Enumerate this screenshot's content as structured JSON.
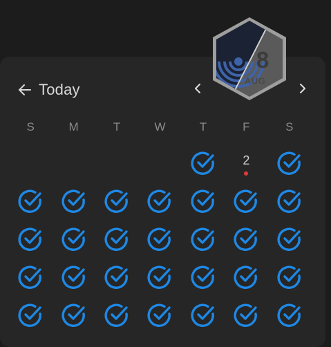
{
  "header": {
    "back_label": "Today",
    "prev_icon": "chevron-left-icon",
    "next_icon": "chevron-right-icon"
  },
  "badge": {
    "day": "8",
    "month": "AUG"
  },
  "weekdays": [
    "S",
    "M",
    "T",
    "W",
    "T",
    "F",
    "S"
  ],
  "calendar": {
    "cells": [
      {
        "type": "empty"
      },
      {
        "type": "empty"
      },
      {
        "type": "empty"
      },
      {
        "type": "empty"
      },
      {
        "type": "check"
      },
      {
        "type": "date",
        "label": "2",
        "has_event": true
      },
      {
        "type": "check"
      },
      {
        "type": "check"
      },
      {
        "type": "check"
      },
      {
        "type": "check"
      },
      {
        "type": "check"
      },
      {
        "type": "check"
      },
      {
        "type": "check"
      },
      {
        "type": "check"
      },
      {
        "type": "check"
      },
      {
        "type": "check"
      },
      {
        "type": "check"
      },
      {
        "type": "check"
      },
      {
        "type": "check"
      },
      {
        "type": "check"
      },
      {
        "type": "check"
      },
      {
        "type": "check"
      },
      {
        "type": "check"
      },
      {
        "type": "check"
      },
      {
        "type": "check"
      },
      {
        "type": "check"
      },
      {
        "type": "check"
      },
      {
        "type": "check"
      },
      {
        "type": "check"
      },
      {
        "type": "check"
      },
      {
        "type": "check"
      },
      {
        "type": "check"
      },
      {
        "type": "check"
      },
      {
        "type": "check"
      },
      {
        "type": "check"
      }
    ]
  },
  "colors": {
    "accent": "#1e88e5",
    "event_dot": "#e53935"
  }
}
